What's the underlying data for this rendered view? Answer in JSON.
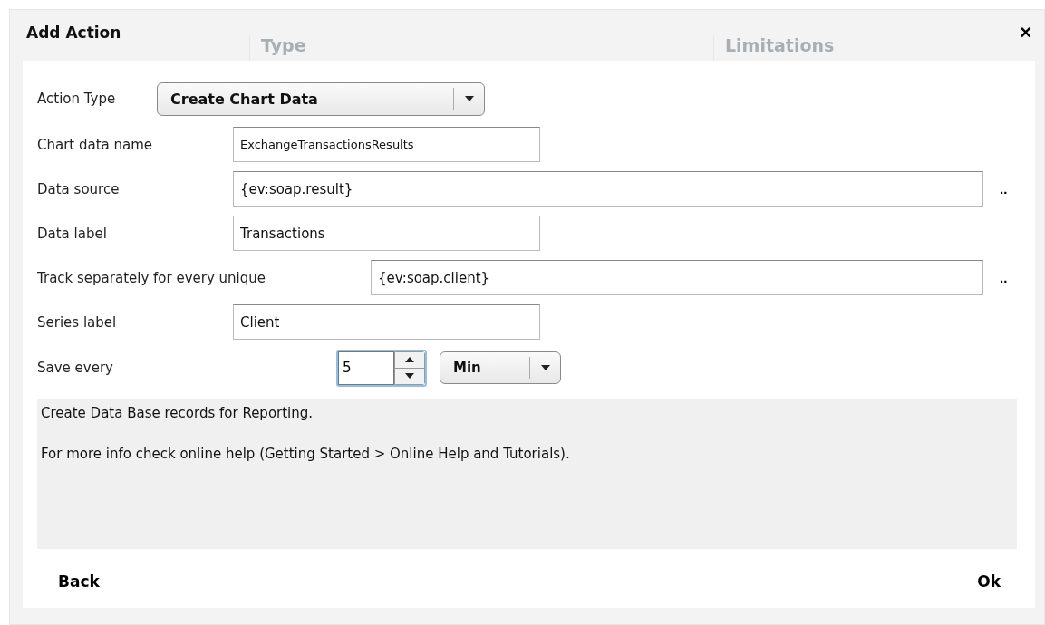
{
  "background_table": {
    "columns": [
      "Type",
      "Limitations"
    ]
  },
  "dialog": {
    "title": "Add Action",
    "close": "×"
  },
  "action_type": {
    "label": "Action Type",
    "value": "Create Chart Data"
  },
  "fields": [
    {
      "kind": "short",
      "label": "Chart data name",
      "value": "ExchangeTransactionsResults",
      "small": true
    },
    {
      "kind": "long",
      "label": "Data source",
      "value": "{ev:soap.result}",
      "browse": ".."
    },
    {
      "kind": "short",
      "label": "Data label",
      "value": "Transactions"
    },
    {
      "kind": "long",
      "label": "Track separately for every unique",
      "value": "{ev:soap.client}",
      "browse": ".."
    },
    {
      "kind": "short",
      "label": "Series label",
      "value": "Client"
    },
    {
      "kind": "interval",
      "label": "Save every",
      "value": "5",
      "focused": true,
      "unit": "Min"
    }
  ],
  "description": [
    "Create Data Base records for Reporting.",
    "For more info check online help (Getting Started > Online Help and Tutorials)."
  ],
  "buttons": {
    "back": "Back",
    "ok": "Ok"
  }
}
